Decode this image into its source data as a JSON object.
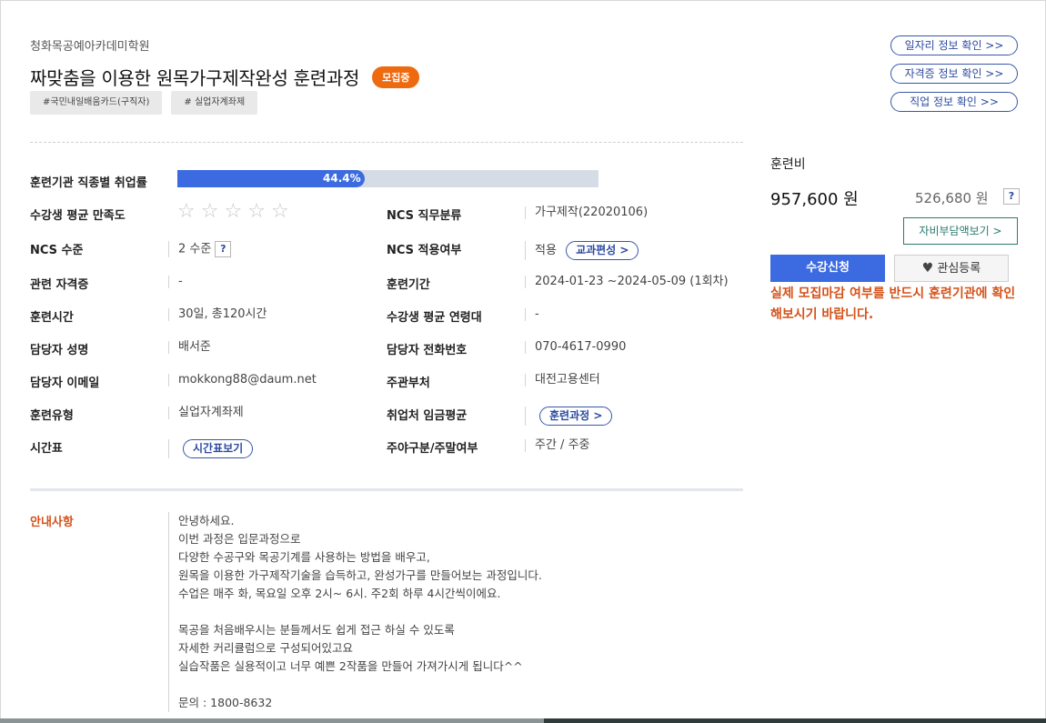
{
  "header": {
    "institution": "청화목공예아카데미학원",
    "course_title": "짜맞춤을 이용한 원목가구제작완성 훈련과정",
    "status_badge": "모집중",
    "tags": [
      "#국민내일배움카드(구직자)",
      "# 실업자계좌제"
    ]
  },
  "right_links": [
    "일자리 정보 확인 >>",
    "자격증 정보 확인 >>",
    "직업 정보 확인 >>"
  ],
  "details": {
    "employment_rate_label": "훈련기관 직종별 취업률",
    "employment_rate_text": "44.4%",
    "employment_rate_value": 0.444,
    "satisfaction_label": "수강생 평균 만족도",
    "satisfaction_stars": 0,
    "satisfaction_max": 5,
    "ncs_class_label": "NCS 직무분류",
    "ncs_class_value": "가구제작(22020106)",
    "ncs_level_label": "NCS 수준",
    "ncs_level_value": "2 수준",
    "ncs_applied_label": "NCS 적용여부",
    "ncs_applied_value": "적용",
    "curriculum_button": "교과편성 >",
    "cert_label": "관련 자격증",
    "cert_value": "-",
    "period_label": "훈련기간",
    "period_value": "2024-01-23 ~2024-05-09 (1회차)",
    "hours_label": "훈련시간",
    "hours_value": "30일, 총120시간",
    "age_label": "수강생 평균 연령대",
    "age_value": "-",
    "manager_label": "담당자 성명",
    "manager_value": "배서준",
    "phone_label": "담당자 전화번호",
    "phone_value": "070-4617-0990",
    "email_label": "담당자 이메일",
    "email_value": "mokkong88@daum.net",
    "dept_label": "주관부처",
    "dept_value": "대전고용센터",
    "type_label": "훈련유형",
    "type_value": "실업자계좌제",
    "wage_label": "취업처 임금평균",
    "wage_button": "훈련과정 >",
    "schedule_label": "시간표",
    "schedule_button": "시간표보기",
    "daynight_label": "주야구분/주말여부",
    "daynight_value": "주간 / 주중"
  },
  "notice": {
    "label": "안내사항",
    "lines": [
      "안녕하세요.",
      "이번 과정은 입문과정으로",
      "다양한 수공구와 목공기계를 사용하는 방법을 배우고,",
      "원목을 이용한 가구제작기술을 습득하고, 완성가구를 만들어보는 과정입니다.",
      "수업은 매주 화, 목요일 오후 2시~ 6시. 주2회 하루 4시간씩이에요.",
      "",
      "목공을 처음배우시는 분들께서도 쉽게 접근 하실 수 있도록",
      "자세한 커리큘럼으로 구성되어있고요",
      "실습작품은 실용적이고 너무 예쁜 2작품을 만들어 가져가시게 됩니다^^",
      "",
      "문의 : 1800-8632"
    ]
  },
  "fee": {
    "label": "훈련비",
    "total": "957,600 원",
    "self_pay": "526,680 원",
    "help": "?",
    "self_pay_button": "자비부담액보기 >"
  },
  "actions": {
    "apply": "수강신청",
    "favorite": "관심등록"
  },
  "warning": "실제 모집마감 여부를 반드시 훈련기관에 확인해보시기 바랍니다.",
  "colors": {
    "accent_blue": "#3c6ae0",
    "badge_orange": "#ee6a0f",
    "warning_orange": "#d4521a",
    "link_blue": "#2c4aa0",
    "teal": "#2a7a70"
  }
}
